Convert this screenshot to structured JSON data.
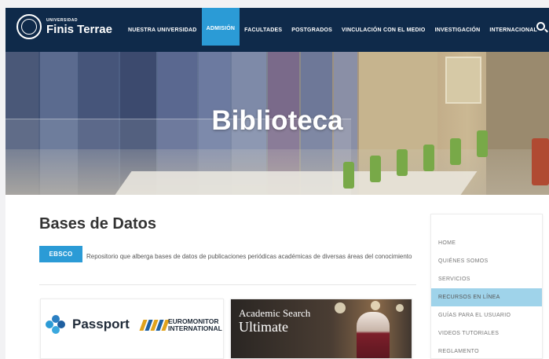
{
  "header": {
    "logo_small": "UNIVERSIDAD",
    "logo_big": "Finis Terrae",
    "nav": [
      {
        "label": "NUESTRA UNIVERSIDAD",
        "active": false
      },
      {
        "label": "ADMISIÓN",
        "active": true
      },
      {
        "label": "FACULTADES",
        "active": false
      },
      {
        "label": "POSTGRADOS",
        "active": false
      },
      {
        "label": "VINCULACIÓN CON EL MEDIO",
        "active": false
      },
      {
        "label": "INVESTIGACIÓN",
        "active": false
      },
      {
        "label": "INTERNACIONAL",
        "active": false
      }
    ],
    "search_icon": "search-icon"
  },
  "hero": {
    "title": "Biblioteca"
  },
  "main": {
    "title": "Bases de Datos",
    "badge": "EBSCO",
    "description": "Repositorio que alberga bases de datos de publicaciones periódicas académicas de diversas áreas del conocimiento",
    "cards": [
      {
        "passport_text": "Passport",
        "euromonitor_line1": "EUROMONITOR",
        "euromonitor_line2": "INTERNATIONAL"
      },
      {
        "line1": "Academic Search",
        "line2": "Ultimate"
      }
    ]
  },
  "sidebar": {
    "items": [
      {
        "label": "HOME",
        "active": false
      },
      {
        "label": "QUIÉNES SOMOS",
        "active": false
      },
      {
        "label": "SERVICIOS",
        "active": false
      },
      {
        "label": "RECURSOS EN LÍNEA",
        "active": true
      },
      {
        "label": "GUÍAS PARA EL USUARIO",
        "active": false
      },
      {
        "label": "VIDEOS TUTORIALES",
        "active": false
      },
      {
        "label": "REGLAMENTO",
        "active": false
      }
    ]
  },
  "colors": {
    "header_bg": "#0f2a4a",
    "accent": "#2b9bd6",
    "sidebar_active": "#9fd3ea"
  }
}
